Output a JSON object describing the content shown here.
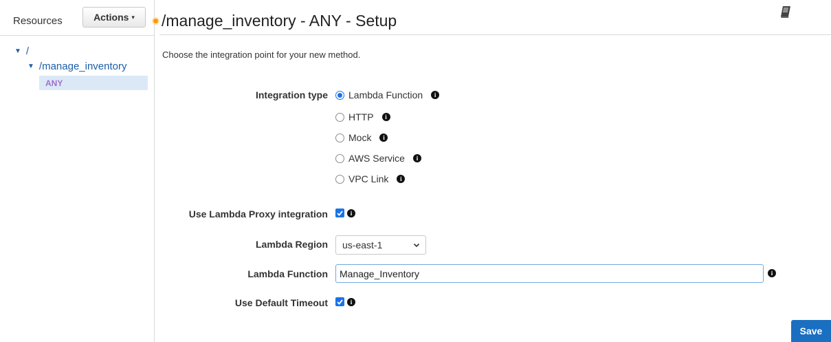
{
  "sidebar": {
    "resources_label": "Resources",
    "actions_label": "Actions",
    "tree": {
      "root": "/",
      "child": "/manage_inventory",
      "method": "ANY"
    }
  },
  "header": {
    "title": "/manage_inventory - ANY - Setup",
    "intro": "Choose the integration point for your new method."
  },
  "form": {
    "integration_type_label": "Integration type",
    "integration_options": [
      {
        "label": "Lambda Function",
        "selected": true
      },
      {
        "label": "HTTP",
        "selected": false
      },
      {
        "label": "Mock",
        "selected": false
      },
      {
        "label": "AWS Service",
        "selected": false
      },
      {
        "label": "VPC Link",
        "selected": false
      }
    ],
    "proxy_label": "Use Lambda Proxy integration",
    "proxy_checked": true,
    "region_label": "Lambda Region",
    "region_value": "us-east-1",
    "function_label": "Lambda Function",
    "function_value": "Manage_Inventory",
    "timeout_label": "Use Default Timeout",
    "timeout_checked": true,
    "save_label": "Save"
  },
  "icons": {
    "info": "info-icon",
    "book": "book-icon",
    "check": "checkmark-icon"
  },
  "colors": {
    "accent": "#1a73e8",
    "save_button": "#1b6fc1",
    "method_text": "#a26ecf",
    "selected_row": "#dbe9f7",
    "title_dot": "#ff9900"
  }
}
